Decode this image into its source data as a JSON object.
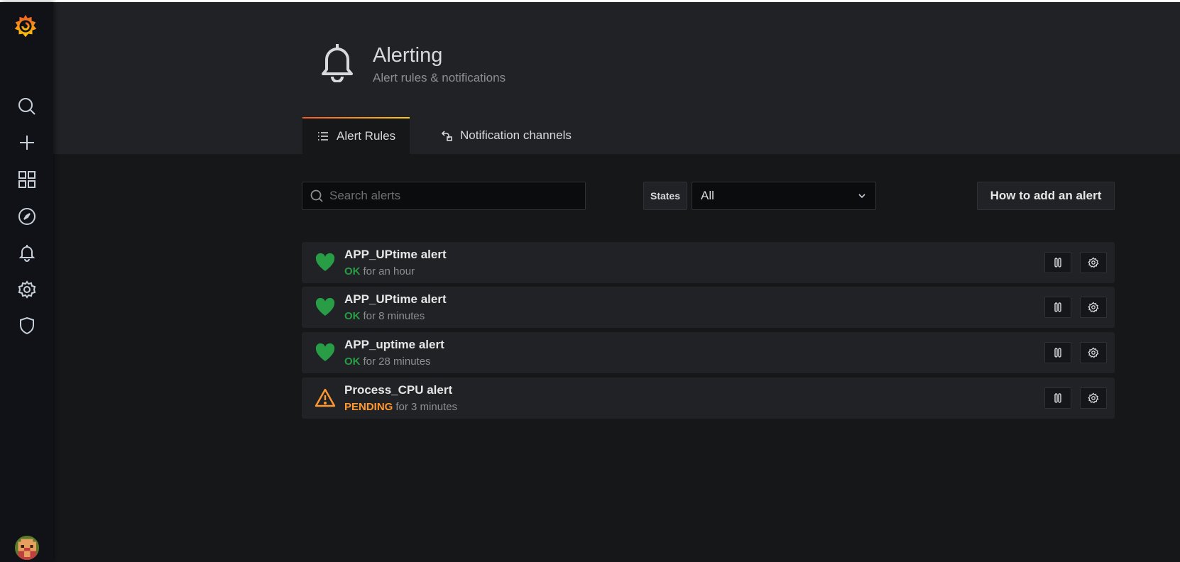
{
  "page": {
    "title": "Alerting",
    "subtitle": "Alert rules & notifications"
  },
  "sidebar": {
    "items": [
      {
        "icon": "search-icon"
      },
      {
        "icon": "plus-icon"
      },
      {
        "icon": "dashboards-icon"
      },
      {
        "icon": "explore-compass-icon"
      },
      {
        "icon": "bell-icon"
      },
      {
        "icon": "gear-icon"
      },
      {
        "icon": "shield-icon"
      }
    ]
  },
  "tabs": [
    {
      "label": "Alert Rules",
      "icon": "list-icon",
      "active": true
    },
    {
      "label": "Notification channels",
      "icon": "channels-icon",
      "active": false
    }
  ],
  "filters": {
    "search_placeholder": "Search alerts",
    "states_label": "States",
    "states_value": "All",
    "howto_label": "How to add an alert"
  },
  "alerts": [
    {
      "name": "APP_UPtime alert",
      "state": "OK",
      "since": "for an hour",
      "icon": "heart-icon"
    },
    {
      "name": "APP_UPtime alert",
      "state": "OK",
      "since": "for 8 minutes",
      "icon": "heart-icon"
    },
    {
      "name": "APP_uptime alert",
      "state": "OK",
      "since": "for 28 minutes",
      "icon": "heart-icon"
    },
    {
      "name": "Process_CPU alert",
      "state": "PENDING",
      "since": "for 3 minutes",
      "icon": "warning-icon"
    }
  ],
  "colors": {
    "ok": "#299c46",
    "pending": "#ff9830",
    "background": "#161719",
    "panel": "#202226"
  }
}
